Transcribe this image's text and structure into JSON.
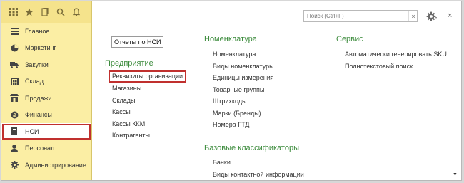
{
  "sidebar": {
    "items": [
      {
        "label": "Главное",
        "icon": "menu-lines-icon"
      },
      {
        "label": "Маркетинг",
        "icon": "pie-chart-icon"
      },
      {
        "label": "Закупки",
        "icon": "truck-icon"
      },
      {
        "label": "Склад",
        "icon": "warehouse-icon"
      },
      {
        "label": "Продажи",
        "icon": "shop-icon"
      },
      {
        "label": "Финансы",
        "icon": "coin-icon"
      },
      {
        "label": "НСИ",
        "icon": "book-icon"
      },
      {
        "label": "Персонал",
        "icon": "person-icon"
      },
      {
        "label": "Администрирование",
        "icon": "gear-icon"
      }
    ]
  },
  "search": {
    "placeholder": "Поиск (Ctrl+F)",
    "clear": "×"
  },
  "toolbar": {
    "close": "×"
  },
  "col1": {
    "reports": "Отчеты по НСИ",
    "enterprise_title": "Предприятие",
    "enterprise_items": [
      "Реквизиты организации",
      "Магазины",
      "Склады",
      "Кассы",
      "Кассы ККМ",
      "Контрагенты"
    ]
  },
  "col2": {
    "nomenclature_title": "Номенклатура",
    "nomenclature_items": [
      "Номенклатура",
      "Виды номенклатуры",
      "Единицы измерения",
      "Товарные группы",
      "Штрихкоды",
      "Марки (Бренды)",
      "Номера ГТД"
    ],
    "classifiers_title": "Базовые классификаторы",
    "classifiers_items": [
      "Банки",
      "Виды контактной информации"
    ]
  },
  "col3": {
    "service_title": "Сервис",
    "service_items": [
      "Автоматически генерировать SKU",
      "Полнотекстовый поиск"
    ]
  },
  "colors": {
    "sidebar": "#fbeea4",
    "accent": "#3a8a3a",
    "highlight": "#c0302e"
  }
}
